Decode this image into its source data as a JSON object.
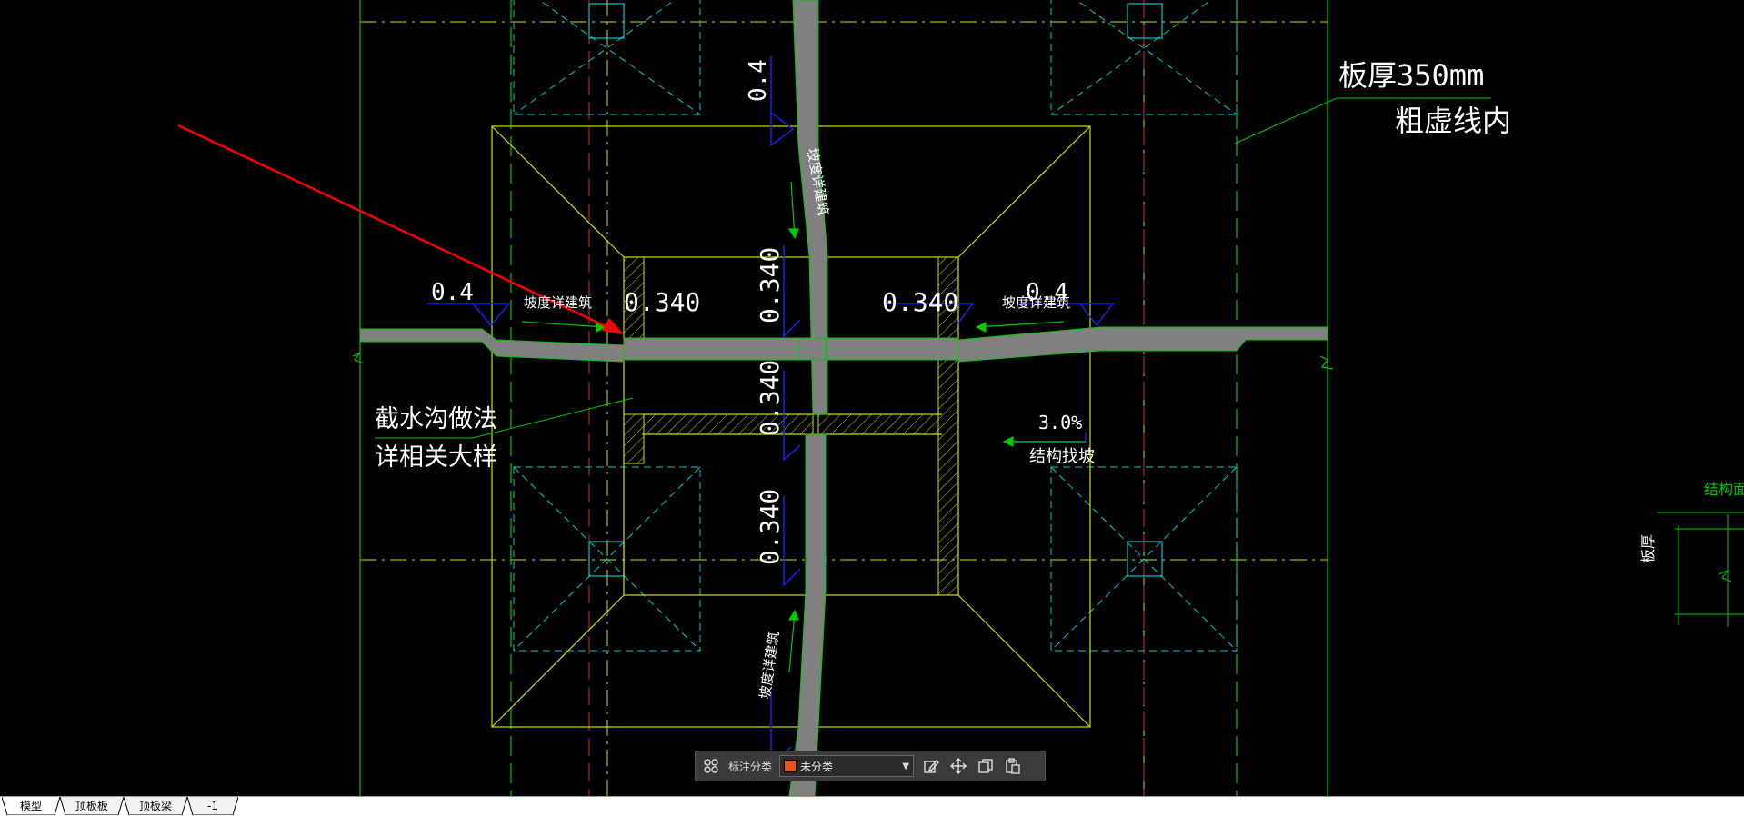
{
  "drawing": {
    "annotations": {
      "slab_thickness": "板厚350mm",
      "inside_dashed": "粗虚线内",
      "gutter_method": "截水沟做法",
      "gutter_detail": "详相关大样",
      "slope_text": "坡度详建筑",
      "slope_percent": "3.0%",
      "structural_slope": "结构找坡",
      "right_edge_title": "结构面标",
      "vertical_label": "板厚"
    },
    "elevations": {
      "val_0_4": "0.4",
      "val_0_340": "0.340"
    }
  },
  "toolbar": {
    "label": "标注分类",
    "category_value": "未分类",
    "swatch_color": "#e8541e",
    "icons": [
      "grid-icon",
      "edit-icon",
      "move-icon",
      "copy-icon",
      "paste-icon"
    ]
  },
  "tabs": [
    {
      "label": "模型",
      "active": true
    },
    {
      "label": "顶板板",
      "active": false
    },
    {
      "label": "顶板梁",
      "active": false
    },
    {
      "label": "-1",
      "active": false
    }
  ],
  "colors": {
    "background": "#000000",
    "yellow_line": "#c8e000",
    "green_line": "#00c800",
    "cyan_line": "#00c8c8",
    "blue_line": "#2020ff",
    "slab_fill": "#808080",
    "red_arrow": "#ff0000"
  }
}
